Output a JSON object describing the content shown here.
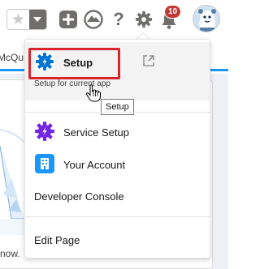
{
  "header": {
    "notification_count": "10"
  },
  "tab": {
    "title_fragment": "McQu"
  },
  "page": {
    "partial_text": "now."
  },
  "setup_menu": {
    "setup": {
      "label": "Setup",
      "sublabel": "Setup for current app"
    },
    "tooltip": "Setup",
    "items": [
      {
        "label": "Service Setup",
        "icon": "gear-icon",
        "icon_color": "#7526e3"
      },
      {
        "label": "Your Account",
        "icon": "building-icon",
        "icon_color": "#1b96ff"
      },
      {
        "label": "Developer Console"
      },
      {
        "label": "Edit Page"
      }
    ]
  },
  "colors": {
    "highlight_border": "#d9262c",
    "setup_icon_bg": "#0176d3",
    "tab_accent": "#1b96ff",
    "badge": "#c23934"
  }
}
